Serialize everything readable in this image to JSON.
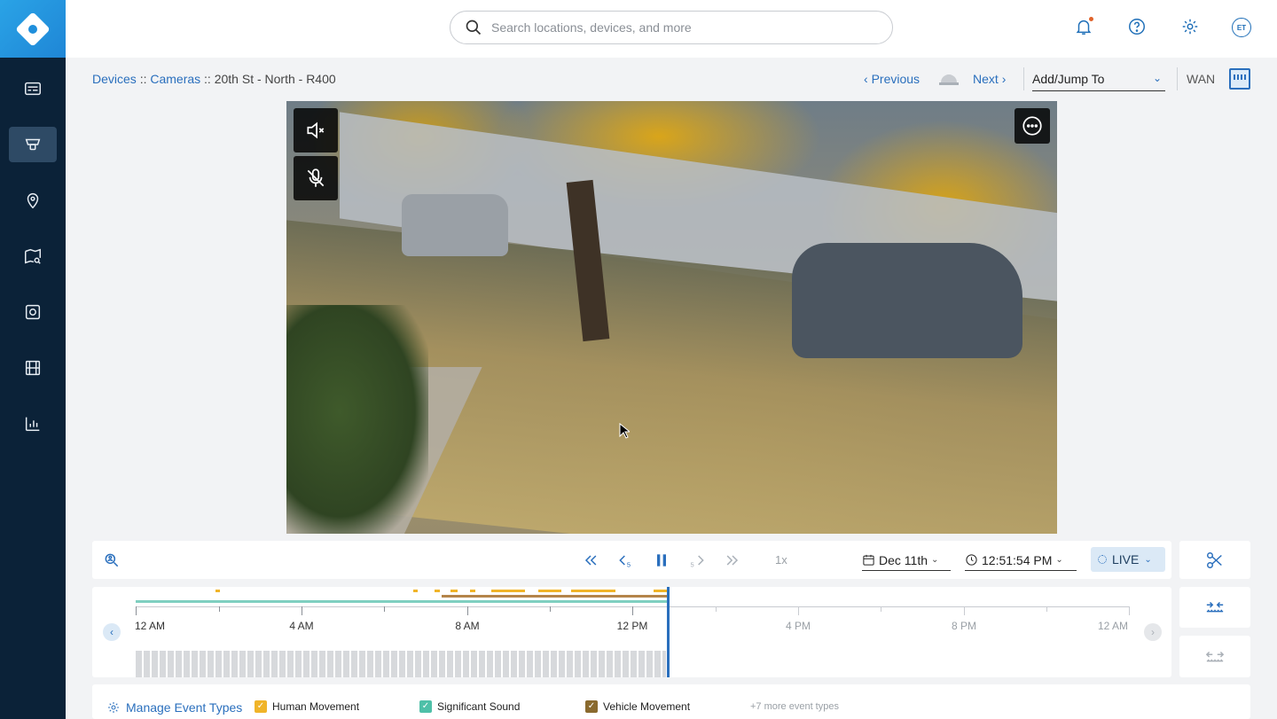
{
  "search": {
    "placeholder": "Search locations, devices, and more"
  },
  "header": {
    "avatar_initials": "ET"
  },
  "sidebar": {
    "items": [
      {
        "icon": "dashboard-icon"
      },
      {
        "icon": "cameras-icon",
        "active": true
      },
      {
        "icon": "location-pin-icon"
      },
      {
        "icon": "map-search-icon"
      },
      {
        "icon": "access-control-icon"
      },
      {
        "icon": "film-icon"
      },
      {
        "icon": "analytics-icon"
      }
    ]
  },
  "breadcrumb": {
    "devices": "Devices",
    "sep1": "::",
    "cameras": "Cameras",
    "sep2": "::",
    "current": "20th St - North - R400"
  },
  "nav": {
    "previous": "Previous",
    "next": "Next",
    "jump_label": "Add/Jump To",
    "wan": "WAN"
  },
  "player": {
    "speed": "1x",
    "date": "Dec 11th",
    "time": "12:51:54 PM",
    "live": "LIVE",
    "skip_back_label": "5",
    "skip_fwd_label": "5"
  },
  "timeline": {
    "labels": [
      {
        "text": "12 AM",
        "future": false
      },
      {
        "text": "4 AM",
        "future": false
      },
      {
        "text": "8 AM",
        "future": false
      },
      {
        "text": "12 PM",
        "future": false
      },
      {
        "text": "4 PM",
        "future": true
      },
      {
        "text": "8 PM",
        "future": true
      },
      {
        "text": "12 AM",
        "future": true
      }
    ]
  },
  "legend": {
    "manage": "Manage Event Types",
    "items": [
      {
        "label": "Human Movement",
        "color": "#f0b429"
      },
      {
        "label": "Significant Sound",
        "color": "#4fc0a8"
      },
      {
        "label": "Vehicle Movement",
        "color": "#8a6a2e"
      }
    ],
    "more": "+7 more event types"
  },
  "colors": {
    "accent": "#2a6fbd",
    "sidebar": "#0b2238",
    "live_bg": "#dbe9f6"
  }
}
